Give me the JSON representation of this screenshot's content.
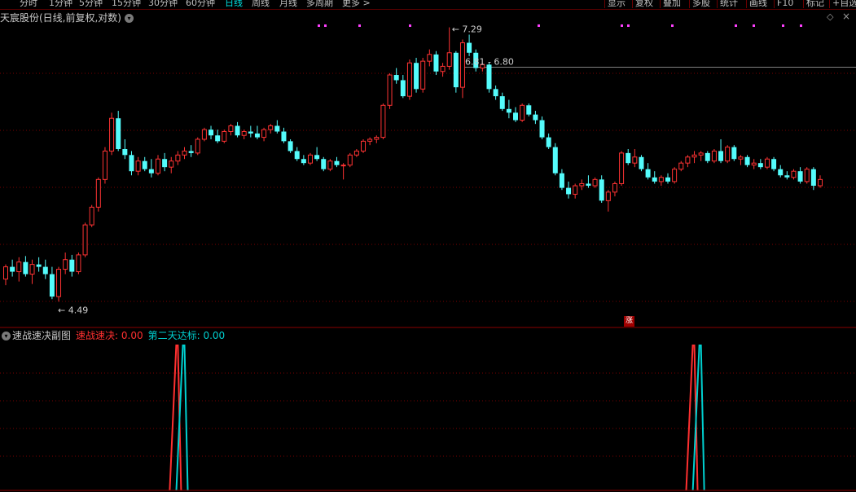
{
  "toolbar": {
    "timeframes": [
      "分时",
      "1分钟",
      "5分钟",
      "15分钟",
      "30分钟",
      "60分钟",
      "日线",
      "周线",
      "月线",
      "多周期",
      "更多 >"
    ],
    "active_timeframe": "日线",
    "buttons": [
      "显示",
      "复权",
      "叠加",
      "多股",
      "统计",
      "画线",
      "F10",
      "标记",
      "+自选"
    ]
  },
  "header": {
    "stock_title": "天宸股份(日线,前复权,对数)",
    "dropdown_icon": "chevron-down-icon",
    "diamond_icon": "diamond-icon",
    "close_icon": "close-icon"
  },
  "annotations": {
    "high_label": "7.29",
    "low_label": "4.49",
    "price_line_label": "6.81 - 6.80",
    "zhang_badge": "涨"
  },
  "sub_indicator": {
    "name": "速战速决副图",
    "legend": [
      {
        "label": "速战速决: 0.00",
        "color": "#ff3030"
      },
      {
        "label": "第二天达标: 0.00",
        "color": "#00d0d0"
      }
    ]
  },
  "colors": {
    "up": "#ff3333",
    "down": "#54fcfc",
    "grid": "#7a0000",
    "price_line": "#808080"
  },
  "chart_data": {
    "type": "candlestick",
    "scale": "log",
    "price_range": [
      4.4,
      7.45
    ],
    "high": 7.29,
    "low": 4.49,
    "price_line": 6.81,
    "candles": [
      [
        4.74,
        4.86,
        4.69,
        4.84
      ],
      [
        4.84,
        4.9,
        4.76,
        4.8
      ],
      [
        4.8,
        4.92,
        4.72,
        4.88
      ],
      [
        4.88,
        4.93,
        4.76,
        4.78
      ],
      [
        4.78,
        4.9,
        4.7,
        4.86
      ],
      [
        4.86,
        4.92,
        4.8,
        4.84
      ],
      [
        4.84,
        4.9,
        4.74,
        4.78
      ],
      [
        4.78,
        4.84,
        4.58,
        4.6
      ],
      [
        4.6,
        4.84,
        4.56,
        4.82
      ],
      [
        4.82,
        4.96,
        4.78,
        4.9
      ],
      [
        4.9,
        4.94,
        4.76,
        4.8
      ],
      [
        4.8,
        4.96,
        4.78,
        4.94
      ],
      [
        4.94,
        5.22,
        4.92,
        5.2
      ],
      [
        5.2,
        5.38,
        5.18,
        5.36
      ],
      [
        5.36,
        5.64,
        5.32,
        5.62
      ],
      [
        5.62,
        5.94,
        5.58,
        5.9
      ],
      [
        5.9,
        6.3,
        5.86,
        6.24
      ],
      [
        6.24,
        6.32,
        5.9,
        5.92
      ],
      [
        5.92,
        6.02,
        5.82,
        5.86
      ],
      [
        5.86,
        5.9,
        5.66,
        5.7
      ],
      [
        5.7,
        5.84,
        5.66,
        5.8
      ],
      [
        5.8,
        5.84,
        5.7,
        5.72
      ],
      [
        5.72,
        5.82,
        5.64,
        5.68
      ],
      [
        5.68,
        5.86,
        5.66,
        5.82
      ],
      [
        5.82,
        5.88,
        5.7,
        5.74
      ],
      [
        5.74,
        5.84,
        5.68,
        5.8
      ],
      [
        5.8,
        5.9,
        5.76,
        5.86
      ],
      [
        5.86,
        5.94,
        5.82,
        5.9
      ],
      [
        5.9,
        5.96,
        5.84,
        5.88
      ],
      [
        5.88,
        6.04,
        5.86,
        6.02
      ],
      [
        6.02,
        6.14,
        6.0,
        6.12
      ],
      [
        6.12,
        6.16,
        6.02,
        6.06
      ],
      [
        6.06,
        6.12,
        5.98,
        6.0
      ],
      [
        6.0,
        6.12,
        5.98,
        6.1
      ],
      [
        6.1,
        6.18,
        6.06,
        6.16
      ],
      [
        6.16,
        6.2,
        6.04,
        6.06
      ],
      [
        6.06,
        6.12,
        6.02,
        6.1
      ],
      [
        6.1,
        6.16,
        6.04,
        6.08
      ],
      [
        6.08,
        6.16,
        6.02,
        6.04
      ],
      [
        6.04,
        6.14,
        6.0,
        6.12
      ],
      [
        6.12,
        6.18,
        6.08,
        6.16
      ],
      [
        6.16,
        6.22,
        6.08,
        6.1
      ],
      [
        6.1,
        6.14,
        5.98,
        6.0
      ],
      [
        6.0,
        6.02,
        5.88,
        5.9
      ],
      [
        5.9,
        5.94,
        5.8,
        5.82
      ],
      [
        5.82,
        5.86,
        5.76,
        5.78
      ],
      [
        5.78,
        5.88,
        5.76,
        5.86
      ],
      [
        5.86,
        5.94,
        5.8,
        5.82
      ],
      [
        5.82,
        5.84,
        5.7,
        5.72
      ],
      [
        5.72,
        5.82,
        5.7,
        5.8
      ],
      [
        5.8,
        5.84,
        5.74,
        5.76
      ],
      [
        5.76,
        5.78,
        5.62,
        5.76
      ],
      [
        5.76,
        5.88,
        5.74,
        5.86
      ],
      [
        5.86,
        5.92,
        5.84,
        5.9
      ],
      [
        5.9,
        6.02,
        5.88,
        6.0
      ],
      [
        6.0,
        6.04,
        5.96,
        6.02
      ],
      [
        6.02,
        6.06,
        5.98,
        6.04
      ],
      [
        6.04,
        6.4,
        6.02,
        6.38
      ],
      [
        6.38,
        6.74,
        6.34,
        6.72
      ],
      [
        6.72,
        6.8,
        6.62,
        6.66
      ],
      [
        6.66,
        6.72,
        6.46,
        6.48
      ],
      [
        6.48,
        6.9,
        6.44,
        6.86
      ],
      [
        6.86,
        6.92,
        6.52,
        6.56
      ],
      [
        6.56,
        6.92,
        6.52,
        6.88
      ],
      [
        6.88,
        7.02,
        6.82,
        6.96
      ],
      [
        6.96,
        7.0,
        6.72,
        6.76
      ],
      [
        6.76,
        6.86,
        6.7,
        6.82
      ],
      [
        6.82,
        7.29,
        6.78,
        6.98
      ],
      [
        6.98,
        7.0,
        6.52,
        6.58
      ],
      [
        6.58,
        7.14,
        6.46,
        7.1
      ],
      [
        7.1,
        7.2,
        6.94,
        6.98
      ],
      [
        6.98,
        7.02,
        6.76,
        6.8
      ],
      [
        6.8,
        6.86,
        6.76,
        6.84
      ],
      [
        6.84,
        6.86,
        6.52,
        6.56
      ],
      [
        6.56,
        6.6,
        6.44,
        6.48
      ],
      [
        6.48,
        6.52,
        6.32,
        6.34
      ],
      [
        6.34,
        6.44,
        6.24,
        6.3
      ],
      [
        6.3,
        6.36,
        6.2,
        6.22
      ],
      [
        6.22,
        6.4,
        6.2,
        6.38
      ],
      [
        6.38,
        6.4,
        6.26,
        6.28
      ],
      [
        6.28,
        6.32,
        6.18,
        6.22
      ],
      [
        6.22,
        6.26,
        6.02,
        6.04
      ],
      [
        6.04,
        6.08,
        5.92,
        5.94
      ],
      [
        5.94,
        5.98,
        5.66,
        5.68
      ],
      [
        5.68,
        5.72,
        5.52,
        5.54
      ],
      [
        5.54,
        5.6,
        5.44,
        5.48
      ],
      [
        5.48,
        5.58,
        5.44,
        5.56
      ],
      [
        5.56,
        5.62,
        5.52,
        5.58
      ],
      [
        5.58,
        5.66,
        5.54,
        5.56
      ],
      [
        5.56,
        5.64,
        5.54,
        5.62
      ],
      [
        5.62,
        5.66,
        5.4,
        5.42
      ],
      [
        5.42,
        5.52,
        5.32,
        5.5
      ],
      [
        5.5,
        5.6,
        5.46,
        5.58
      ],
      [
        5.58,
        5.9,
        5.56,
        5.88
      ],
      [
        5.88,
        5.92,
        5.76,
        5.78
      ],
      [
        5.78,
        5.92,
        5.74,
        5.84
      ],
      [
        5.84,
        5.86,
        5.7,
        5.72
      ],
      [
        5.72,
        5.78,
        5.62,
        5.64
      ],
      [
        5.64,
        5.7,
        5.58,
        5.6
      ],
      [
        5.6,
        5.66,
        5.56,
        5.64
      ],
      [
        5.64,
        5.68,
        5.58,
        5.6
      ],
      [
        5.6,
        5.74,
        5.58,
        5.72
      ],
      [
        5.72,
        5.8,
        5.7,
        5.78
      ],
      [
        5.78,
        5.86,
        5.74,
        5.84
      ],
      [
        5.84,
        5.9,
        5.78,
        5.86
      ],
      [
        5.86,
        5.9,
        5.8,
        5.88
      ],
      [
        5.88,
        5.9,
        5.78,
        5.8
      ],
      [
        5.8,
        5.92,
        5.78,
        5.9
      ],
      [
        5.9,
        6.02,
        5.78,
        5.8
      ],
      [
        5.8,
        5.96,
        5.78,
        5.94
      ],
      [
        5.94,
        5.96,
        5.8,
        5.82
      ],
      [
        5.82,
        5.86,
        5.76,
        5.84
      ],
      [
        5.84,
        5.86,
        5.74,
        5.76
      ],
      [
        5.76,
        5.82,
        5.72,
        5.78
      ],
      [
        5.78,
        5.82,
        5.72,
        5.74
      ],
      [
        5.74,
        5.84,
        5.72,
        5.82
      ],
      [
        5.82,
        5.84,
        5.7,
        5.72
      ],
      [
        5.72,
        5.76,
        5.64,
        5.66
      ],
      [
        5.66,
        5.7,
        5.62,
        5.64
      ],
      [
        5.64,
        5.72,
        5.62,
        5.7
      ],
      [
        5.7,
        5.74,
        5.58,
        5.6
      ],
      [
        5.6,
        5.74,
        5.58,
        5.72
      ],
      [
        5.72,
        5.74,
        5.52,
        5.56
      ],
      [
        5.56,
        5.66,
        5.54,
        5.62
      ]
    ],
    "indicator": {
      "name": "速战速决副图",
      "series": [
        {
          "name": "速战速决",
          "color": "#ff3030",
          "signal_bars": [
            26,
            104
          ]
        },
        {
          "name": "第二天达标",
          "color": "#00d0d0",
          "signal_bars": [
            27,
            105
          ]
        }
      ],
      "last_values": [
        0.0,
        0.0
      ]
    }
  }
}
